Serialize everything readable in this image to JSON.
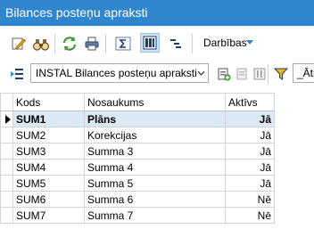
{
  "window": {
    "title": "Bilances posteņu apraksti"
  },
  "toolbar": {
    "actions_menu_label": "Darbības"
  },
  "filterbar": {
    "layout_value": "INSTAL Bilances posteņu apraksti",
    "quick_filter_value": "_Ātra"
  },
  "grid": {
    "columns": [
      "Kods",
      "Nosaukums",
      "Aktīvs"
    ],
    "rows": [
      {
        "kods": "SUM1",
        "nosaukums": "Plāns",
        "aktivs": "Jā"
      },
      {
        "kods": "SUM2",
        "nosaukums": "Korekcijas",
        "aktivs": "Jā"
      },
      {
        "kods": "SUM3",
        "nosaukums": "Summa 3",
        "aktivs": "Jā"
      },
      {
        "kods": "SUM4",
        "nosaukums": "Summa 4",
        "aktivs": "Jā"
      },
      {
        "kods": "SUM5",
        "nosaukums": "Summa 5",
        "aktivs": "Jā"
      },
      {
        "kods": "SUM6",
        "nosaukums": "Summa 6",
        "aktivs": "Nē"
      },
      {
        "kods": "SUM7",
        "nosaukums": "Summa 7",
        "aktivs": "Nē"
      }
    ]
  },
  "colors": {
    "titlebar": "#2f86cd",
    "selected_row": "#dbe9f7",
    "active_tool": "#cce4f7"
  }
}
